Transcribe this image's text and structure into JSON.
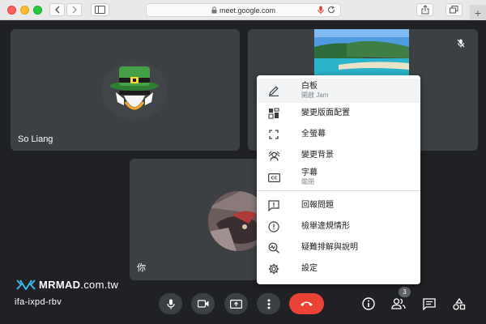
{
  "browser": {
    "url": "meet.google.com",
    "new_tab_symbol": "+"
  },
  "tiles": [
    {
      "name": "So Liang"
    },
    {
      "name": ""
    },
    {
      "name": "你"
    }
  ],
  "watermark": {
    "brand": "MRMAD",
    "suffix": ".com.tw"
  },
  "meeting_code": "ifa-ixpd-rbv",
  "participants_count": "3",
  "menu": {
    "items": [
      {
        "label": "白板",
        "sub": "開啟 Jam",
        "icon": "pencil-icon"
      },
      {
        "label": "變更版面配置",
        "icon": "layout-icon"
      },
      {
        "label": "全螢幕",
        "icon": "fullscreen-icon"
      },
      {
        "label": "變更背景",
        "icon": "background-icon"
      },
      {
        "label": "字幕",
        "sub": "關閉",
        "icon": "captions-icon"
      },
      {
        "label": "回報問題",
        "icon": "feedback-icon"
      },
      {
        "label": "檢舉違規情形",
        "icon": "report-icon"
      },
      {
        "label": "疑難排解與說明",
        "icon": "troubleshoot-icon"
      },
      {
        "label": "設定",
        "icon": "settings-gear-icon"
      }
    ]
  },
  "colors": {
    "background": "#202124",
    "tile": "#3c4043",
    "hangup": "#ea4335"
  }
}
